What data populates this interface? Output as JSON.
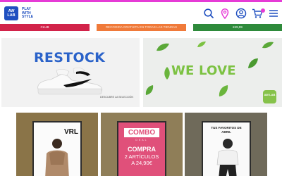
{
  "header": {
    "logo_mark": "AW LAB",
    "logo_tagline": "PLAY WITH STYLE",
    "icons": [
      "search-icon",
      "location-pin-icon",
      "user-icon",
      "cart-icon",
      "menu-icon"
    ],
    "accent": "#e63bd6",
    "brand": "#1f4fc0"
  },
  "promo_strips": [
    {
      "text": "CLUB",
      "color": "#d2234a"
    },
    {
      "text": "RECOGIDA GRATUITA EN TODAS LAS TIENDAS",
      "color": "#f07a3a"
    },
    {
      "text": "€49,99",
      "color": "#2e8a3b"
    }
  ],
  "banners": {
    "left": {
      "headline": "RESTOCK",
      "cta": "DESCUBRE LA SELECCIÓN"
    },
    "right": {
      "headline": "WE LOVE",
      "badge": "AW LAB"
    }
  },
  "tiles": [
    {
      "brand": "VRL"
    },
    {
      "title": "COMBO",
      "subtitle": "DEAL",
      "line1": "COMPRA",
      "line2": "2 ARTÍCULOS",
      "line3": "A 24,90€"
    },
    {
      "title_line1": "TUS FAVORITOS DE",
      "title_line2": "ABRIL"
    }
  ]
}
